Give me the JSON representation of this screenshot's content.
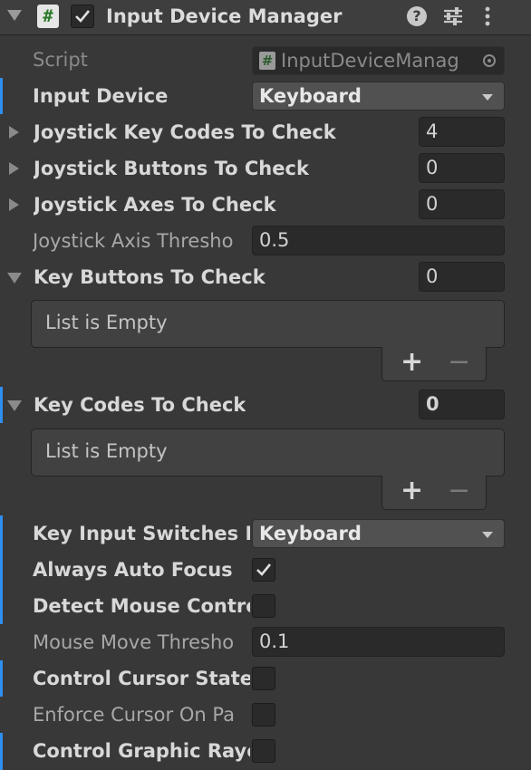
{
  "header": {
    "title": "Input Device Manager",
    "enabled": true,
    "script_icon_glyph": "#",
    "icons": [
      "chevron-down-icon",
      "script-icon",
      "checkbox-icon",
      "help-icon",
      "preset-icon",
      "menu-icon"
    ]
  },
  "fields": {
    "script": {
      "label": "Script",
      "value": "InputDeviceManag"
    },
    "input_device": {
      "label": "Input Device",
      "value": "Keyboard"
    },
    "joystick_key_codes": {
      "label": "Joystick Key Codes To Check",
      "value": "4"
    },
    "joystick_buttons": {
      "label": "Joystick Buttons To Check",
      "value": "0"
    },
    "joystick_axes": {
      "label": "Joystick Axes To Check",
      "value": "0"
    },
    "joystick_axis_threshold": {
      "label": "Joystick Axis Thresho",
      "value": "0.5"
    },
    "key_buttons": {
      "label": "Key Buttons To Check",
      "value": "0",
      "empty_text": "List is Empty",
      "add": "+",
      "remove": "−"
    },
    "key_codes": {
      "label": "Key Codes To Check",
      "value": "0",
      "empty_text": "List is Empty",
      "add": "+",
      "remove": "−"
    },
    "key_input_switches": {
      "label": "Key Input Switches M",
      "value": "Keyboard"
    },
    "always_auto_focus": {
      "label": "Always Auto Focus",
      "checked": true
    },
    "detect_mouse_controls": {
      "label": "Detect Mouse Contro",
      "checked": false
    },
    "mouse_move_threshold": {
      "label": "Mouse Move Thresho",
      "value": "0.1"
    },
    "control_cursor_state": {
      "label": "Control Cursor State",
      "checked": false
    },
    "enforce_cursor_on_pause": {
      "label": "Enforce Cursor On Pa",
      "checked": false
    },
    "control_graphic_raycasters": {
      "label": "Control Graphic Rayc",
      "checked": false
    }
  },
  "colors": {
    "modified_bar": "#2f8ff0",
    "background": "#383838",
    "field": "#2a2a2a",
    "dropdown": "#515151"
  }
}
